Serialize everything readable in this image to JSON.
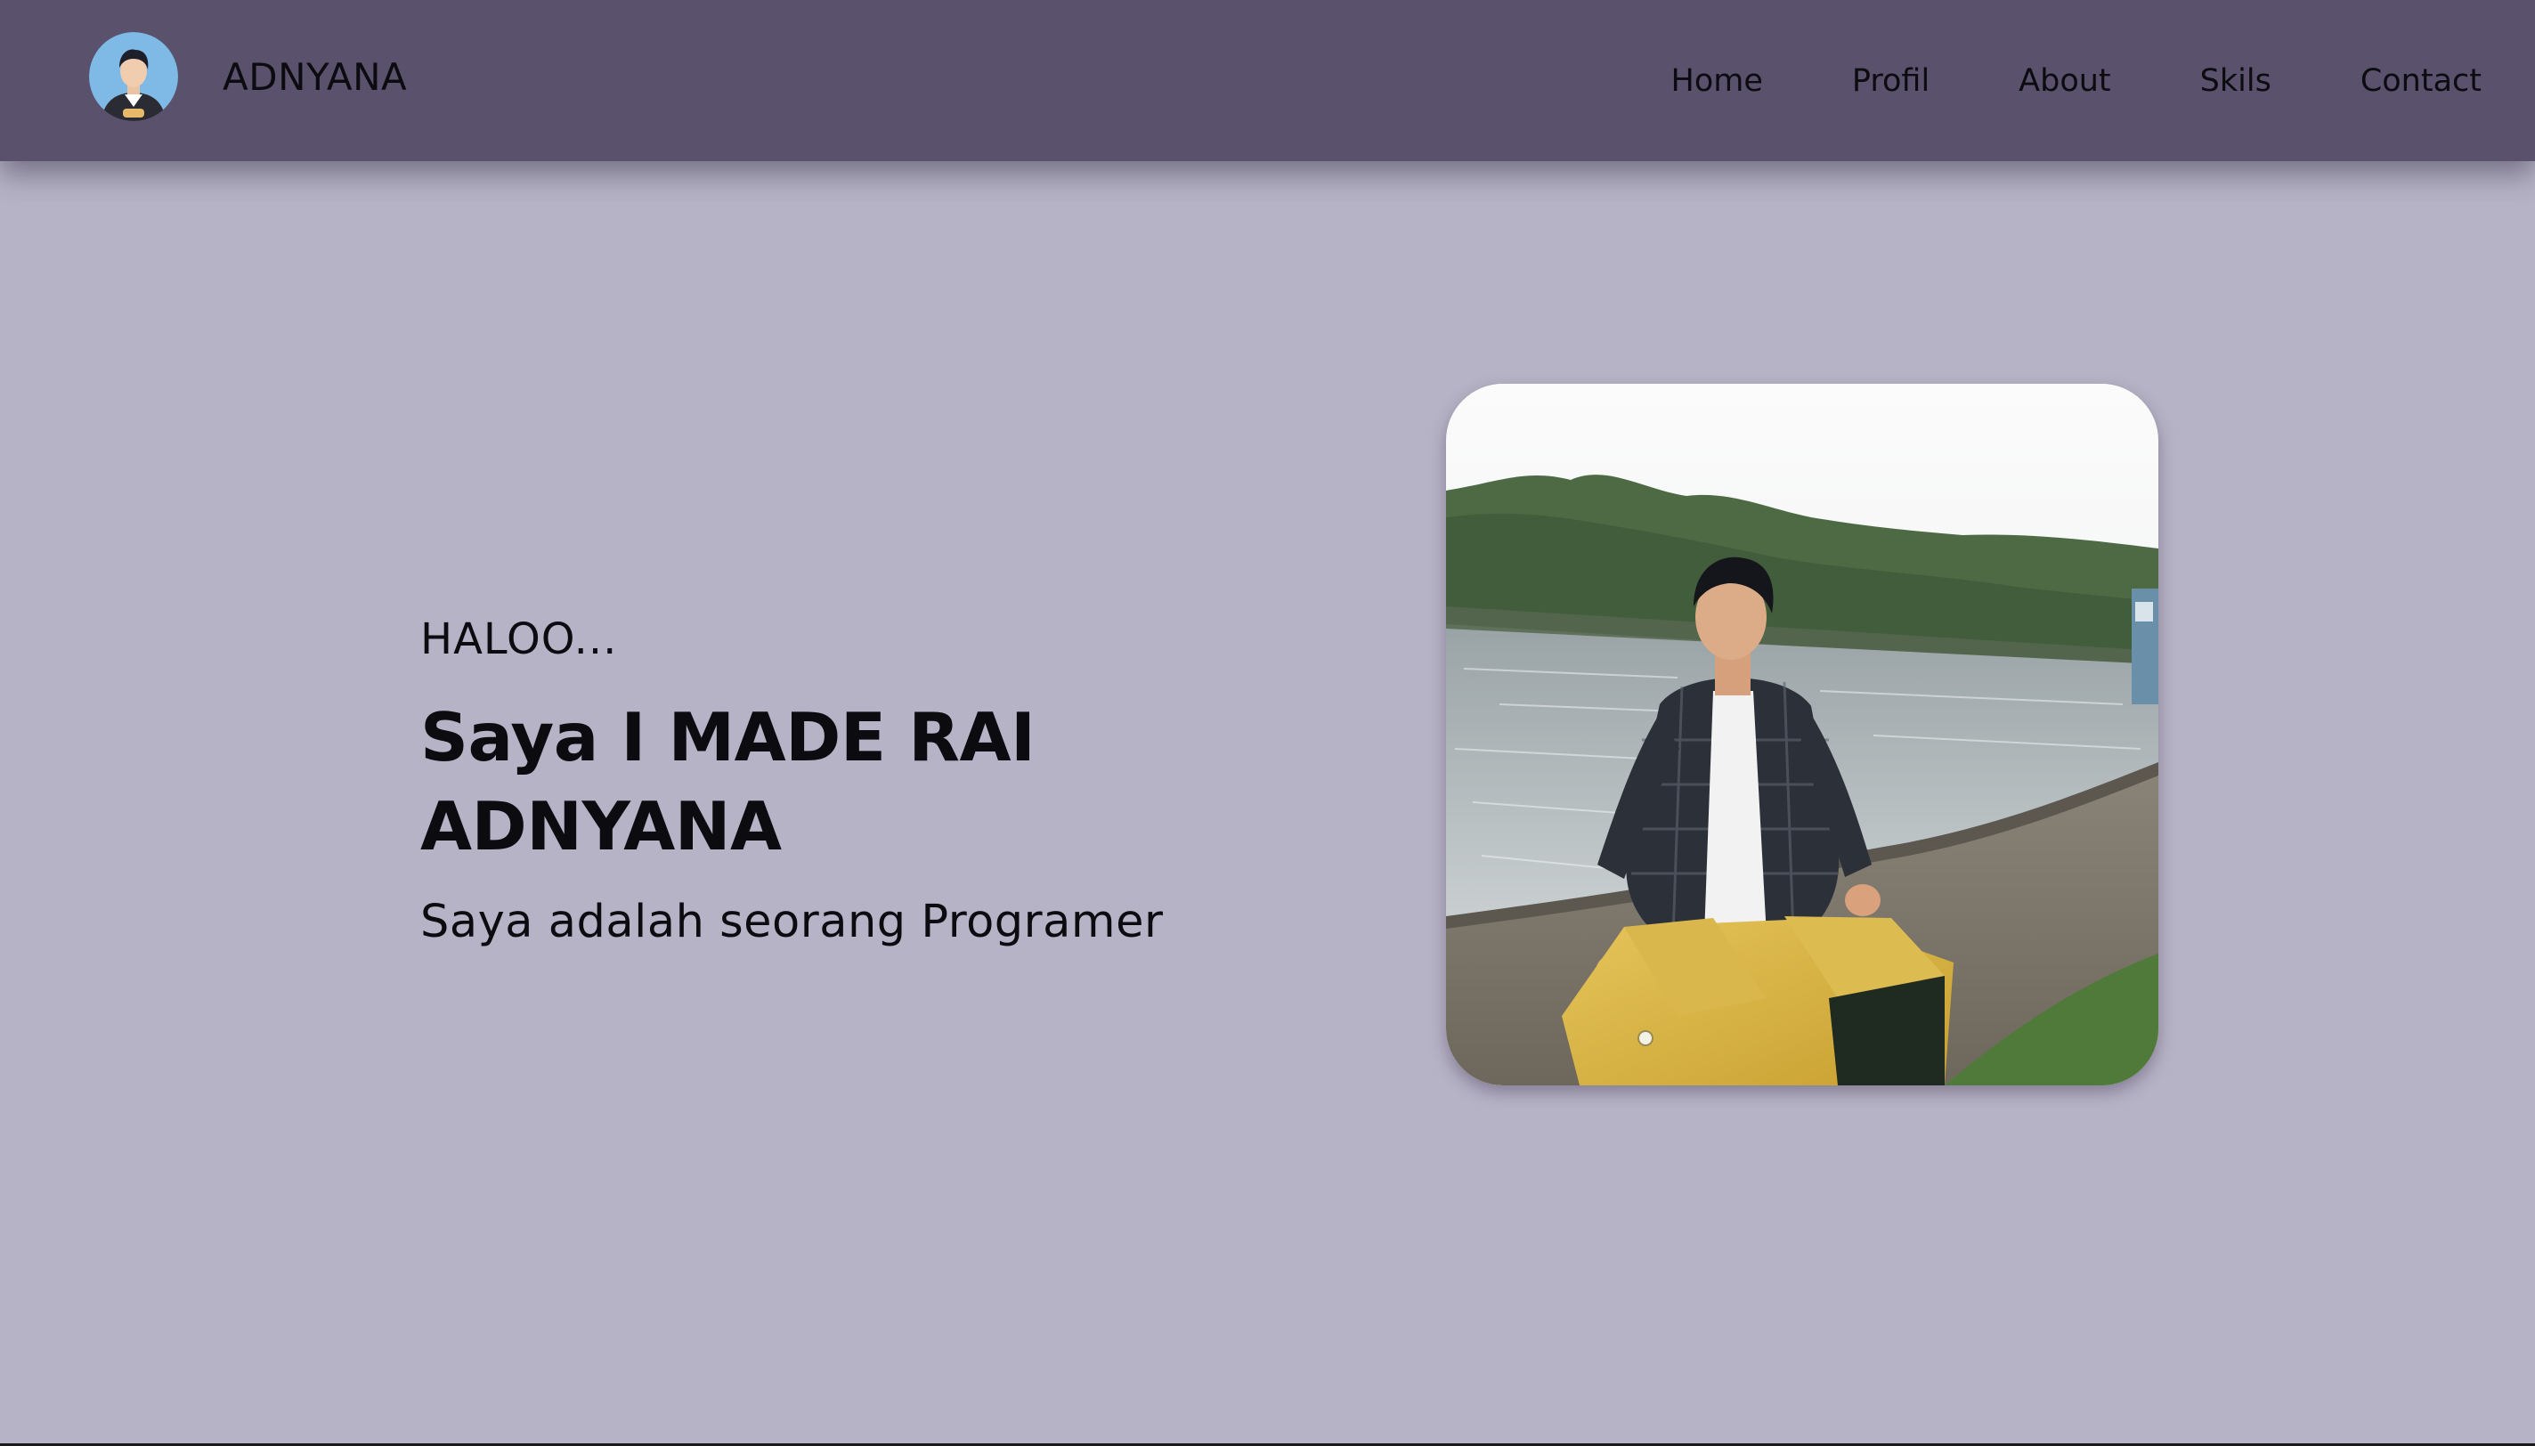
{
  "navbar": {
    "avatar_icon": "avatar-icon",
    "brand_name": "ADNYANA",
    "links": [
      {
        "label": "Home"
      },
      {
        "label": "Profil"
      },
      {
        "label": "About"
      },
      {
        "label": "Skils"
      },
      {
        "label": "Contact"
      }
    ]
  },
  "hero": {
    "greeting": "HALOO...",
    "headline": "Saya I MADE RAI ADNYANA",
    "tagline": "Saya adalah seorang Programer"
  },
  "colors": {
    "page_background": "#b7b3c6",
    "navbar_background": "#5a526d",
    "text": "#0b0b10"
  }
}
